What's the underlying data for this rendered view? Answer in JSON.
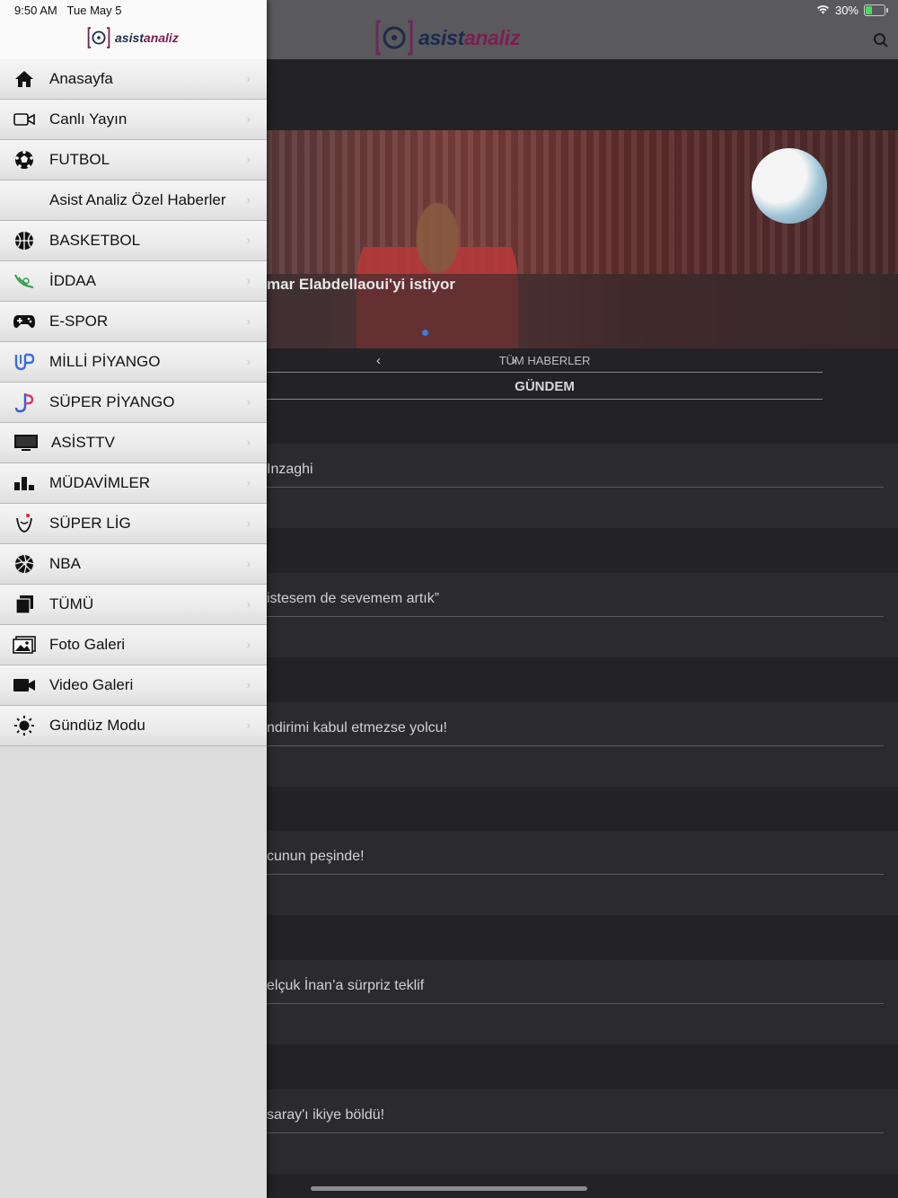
{
  "status": {
    "time": "9:50 AM",
    "date": "Tue May 5",
    "battery": "30%",
    "battery_level": 0.3
  },
  "brand": {
    "part1": "asist",
    "part2": "analiz"
  },
  "drawer": {
    "items": [
      {
        "label": "Anasayfa",
        "icon": "home-icon"
      },
      {
        "label": "Canlı Yayın",
        "icon": "video-camera-outline-icon"
      },
      {
        "label": "FUTBOL",
        "icon": "soccer-ball-icon"
      },
      {
        "label": "Asist Analiz Özel Haberler",
        "icon": ""
      },
      {
        "label": "BASKETBOL",
        "icon": "basketball-icon"
      },
      {
        "label": "İDDAA",
        "icon": "iddaa-icon"
      },
      {
        "label": "E-SPOR",
        "icon": "gamepad-icon"
      },
      {
        "label": "MİLLİ PİYANGO",
        "icon": "milli-piyango-icon"
      },
      {
        "label": "SÜPER PİYANGO",
        "icon": "super-piyango-icon"
      },
      {
        "label": "ASİSTTV",
        "icon": "tv-icon"
      },
      {
        "label": "MÜDAVİMLER",
        "icon": "bar-chart-icon"
      },
      {
        "label": "SÜPER LİG",
        "icon": "super-lig-icon"
      },
      {
        "label": "NBA",
        "icon": "nba-ball-icon"
      },
      {
        "label": "TÜMÜ",
        "icon": "stack-icon"
      },
      {
        "label": "Foto Galeri",
        "icon": "photo-gallery-icon"
      },
      {
        "label": "Video Galeri",
        "icon": "video-camera-icon"
      },
      {
        "label": "Gündüz Modu",
        "icon": "sun-icon"
      }
    ]
  },
  "main": {
    "hero_headline": "mar Elabdellaoui'yi istiyor",
    "all_news": "TÜM HABERLER",
    "section_title": "GÜNDEM",
    "news": [
      "Inzaghi",
      "istesem de sevemem artık”",
      "ndirimi kabul etmezse yolcu!",
      "cunun peşinde!",
      "elçuk İnan’a sürpriz teklif",
      "saray'ı ikiye böldü!"
    ]
  }
}
